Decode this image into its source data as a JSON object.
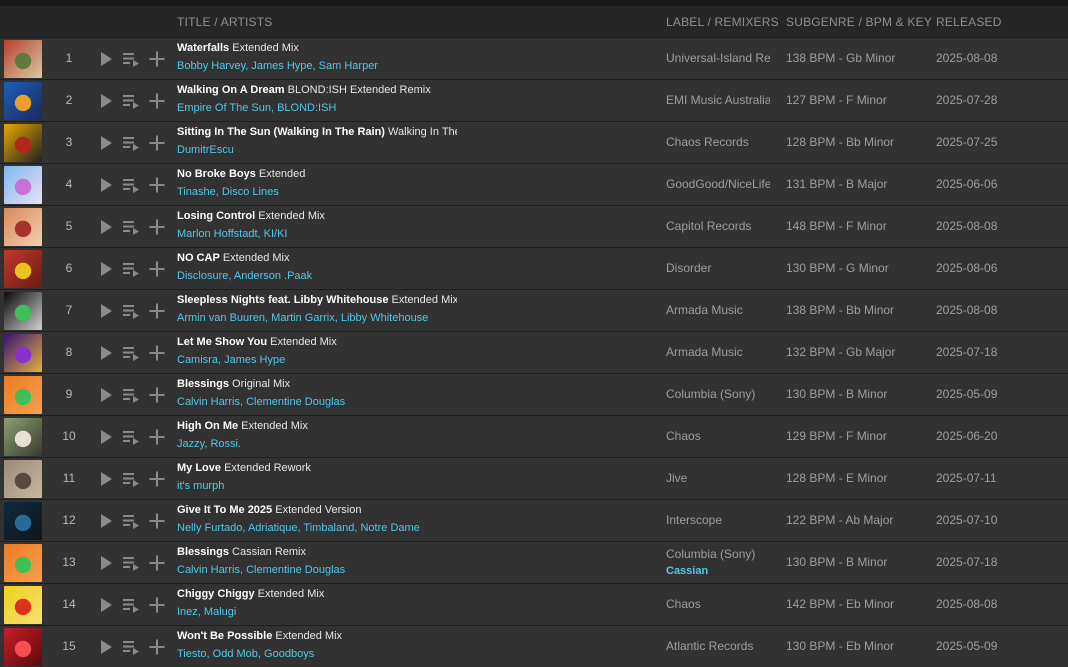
{
  "header": {
    "title_artists": "TITLE / ARTISTS",
    "label_remixers": "LABEL / REMIXERS",
    "subgenre_bpm_key": "SUBGENRE / BPM & KEY",
    "released": "RELEASED"
  },
  "tracks": [
    {
      "num": "1",
      "title": "Waterfalls",
      "mix": "Extended Mix",
      "artists": [
        "Bobby Harvey",
        "James Hype",
        "Sam Harper"
      ],
      "label": "Universal-Island Records",
      "remixer": "",
      "bpm_key": "138 BPM - Gb Minor",
      "released": "2025-08-08",
      "art_colors": [
        "#b8402e",
        "#5f7a3a",
        "#d9c9a3"
      ]
    },
    {
      "num": "2",
      "title": "Walking On A Dream",
      "mix": "BLOND:ISH Extended Remix",
      "artists": [
        "Empire Of The Sun",
        "BLOND:ISH"
      ],
      "label": "EMI Music Australia",
      "remixer": "",
      "bpm_key": "127 BPM - F Minor",
      "released": "2025-07-28",
      "art_colors": [
        "#1c5fb8",
        "#e8a02a",
        "#1a2a60"
      ]
    },
    {
      "num": "3",
      "title": "Sitting In The Sun (Walking In The Rain)",
      "mix": "Walking In The Rain Mix",
      "artists": [
        "DumitrEscu"
      ],
      "label": "Chaos Records",
      "remixer": "",
      "bpm_key": "128 BPM - Bb Minor",
      "released": "2025-07-25",
      "art_colors": [
        "#e6a800",
        "#b3261e",
        "#222222"
      ]
    },
    {
      "num": "4",
      "title": "No Broke Boys",
      "mix": "Extended",
      "artists": [
        "Tinashe",
        "Disco Lines"
      ],
      "label": "GoodGood/NiceLife",
      "remixer": "",
      "bpm_key": "131 BPM - B Major",
      "released": "2025-06-06",
      "art_colors": [
        "#7fb8f0",
        "#c96fd6",
        "#e8e0f5"
      ]
    },
    {
      "num": "5",
      "title": "Losing Control",
      "mix": "Extended Mix",
      "artists": [
        "Marlon Hoffstadt",
        "KI/KI"
      ],
      "label": "Capitol Records",
      "remixer": "",
      "bpm_key": "148 BPM - F Minor",
      "released": "2025-08-08",
      "art_colors": [
        "#d98a5a",
        "#a8322a",
        "#f0d0b0"
      ]
    },
    {
      "num": "6",
      "title": "NO CAP",
      "mix": "Extended Mix",
      "artists": [
        "Disclosure",
        "Anderson .Paak"
      ],
      "label": "Disorder",
      "remixer": "",
      "bpm_key": "130 BPM - G Minor",
      "released": "2025-08-06",
      "art_colors": [
        "#c0392b",
        "#e8c31c",
        "#6a1a14"
      ]
    },
    {
      "num": "7",
      "title": "Sleepless Nights feat. Libby Whitehouse",
      "mix": "Extended Mix",
      "artists": [
        "Armin van Buuren",
        "Martin Garrix",
        "Libby Whitehouse"
      ],
      "label": "Armada Music",
      "remixer": "",
      "bpm_key": "138 BPM - Bb Minor",
      "released": "2025-08-08",
      "art_colors": [
        "#0a0a0a",
        "#3fbf5a",
        "#d0d0d0"
      ]
    },
    {
      "num": "8",
      "title": "Let Me Show You",
      "mix": "Extended Mix",
      "artists": [
        "Camisra",
        "James Hype"
      ],
      "label": "Armada Music",
      "remixer": "",
      "bpm_key": "132 BPM - Gb Major",
      "released": "2025-07-18",
      "art_colors": [
        "#3a1470",
        "#8a2fd0",
        "#e0b040"
      ]
    },
    {
      "num": "9",
      "title": "Blessings",
      "mix": "Original Mix",
      "artists": [
        "Calvin Harris",
        "Clementine Douglas"
      ],
      "label": "Columbia (Sony)",
      "remixer": "",
      "bpm_key": "130 BPM - B Minor",
      "released": "2025-05-09",
      "art_colors": [
        "#f07a20",
        "#3fbf5a",
        "#f5a050"
      ]
    },
    {
      "num": "10",
      "title": "High On Me",
      "mix": "Extended Mix",
      "artists": [
        "Jazzy",
        "Rossi."
      ],
      "label": "Chaos",
      "remixer": "",
      "bpm_key": "129 BPM - F Minor",
      "released": "2025-06-20",
      "art_colors": [
        "#8aa070",
        "#e8e0d0",
        "#3a3a30"
      ]
    },
    {
      "num": "11",
      "title": "My Love",
      "mix": "Extended Rework",
      "artists": [
        "it's murph"
      ],
      "label": "Jive",
      "remixer": "",
      "bpm_key": "128 BPM - E Minor",
      "released": "2025-07-11",
      "art_colors": [
        "#9a8a78",
        "#5a4a3e",
        "#c8b8a0"
      ]
    },
    {
      "num": "12",
      "title": "Give It To Me 2025",
      "mix": "Extended Version",
      "artists": [
        "Nelly Furtado",
        "Adriatique",
        "Timbaland",
        "Notre Dame"
      ],
      "label": "Interscope",
      "remixer": "",
      "bpm_key": "122 BPM - Ab Major",
      "released": "2025-07-10",
      "art_colors": [
        "#0e2a40",
        "#2a6a9a",
        "#101418"
      ]
    },
    {
      "num": "13",
      "title": "Blessings",
      "mix": "Cassian Remix",
      "artists": [
        "Calvin Harris",
        "Clementine Douglas"
      ],
      "label": "Columbia (Sony)",
      "remixer": "Cassian",
      "bpm_key": "130 BPM - B Minor",
      "released": "2025-07-18",
      "art_colors": [
        "#f07a20",
        "#3fbf5a",
        "#f5a050"
      ]
    },
    {
      "num": "14",
      "title": "Chiggy Chiggy",
      "mix": "Extended Mix",
      "artists": [
        "Inez",
        "Malugi"
      ],
      "label": "Chaos",
      "remixer": "",
      "bpm_key": "142 BPM - Eb Minor",
      "released": "2025-08-08",
      "art_colors": [
        "#f0d020",
        "#e03020",
        "#f5e070"
      ]
    },
    {
      "num": "15",
      "title": "Won't Be Possible",
      "mix": "Extended Mix",
      "artists": [
        "Tiesto",
        "Odd Mob",
        "Goodboys"
      ],
      "label": "Atlantic Records",
      "remixer": "",
      "bpm_key": "130 BPM - Eb Minor",
      "released": "2025-05-09",
      "art_colors": [
        "#c81e28",
        "#f05050",
        "#5a0a10"
      ]
    }
  ],
  "icons": {
    "play": "play-icon",
    "queue": "add-to-queue-icon",
    "add": "plus-icon"
  },
  "colors": {
    "artist_link": "#4fc8e8",
    "row_bg": "#323232",
    "header_bg": "#262626"
  }
}
